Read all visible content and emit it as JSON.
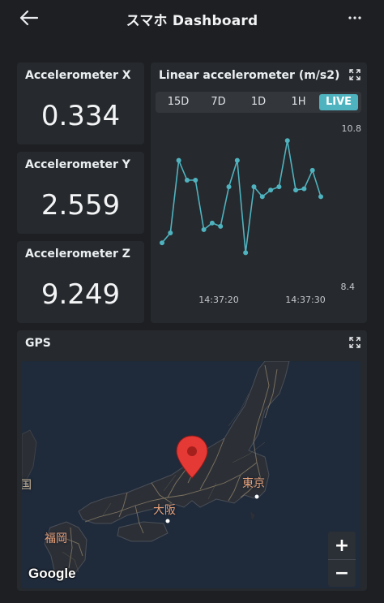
{
  "appbar": {
    "title": "スマホ Dashboard",
    "back_icon": "arrow-left-icon",
    "more_icon": "more-horizontal-icon"
  },
  "stats": [
    {
      "label": "Accelerometer X",
      "value": "0.334"
    },
    {
      "label": "Accelerometer Y",
      "value": "2.559"
    },
    {
      "label": "Accelerometer Z",
      "value": "9.249"
    }
  ],
  "linear_chart": {
    "title": "Linear accelerometer (m/s2)",
    "ranges": [
      "15D",
      "7D",
      "1D",
      "1H",
      "LIVE"
    ],
    "active_range": "LIVE",
    "accent": "#4fb3bf"
  },
  "chart_data": {
    "type": "line",
    "title": "Linear accelerometer (m/s2)",
    "ylim": [
      8.4,
      10.8
    ],
    "y_ticks": [
      "10.8",
      "8.4"
    ],
    "x_ticks": [
      "14:37:20",
      "14:37:30"
    ],
    "series": [
      {
        "color": "#4fb3bf",
        "values": [
          9.05,
          9.2,
          10.3,
          10.0,
          10.0,
          9.25,
          9.35,
          9.3,
          9.9,
          10.3,
          8.9,
          9.9,
          9.75,
          9.85,
          9.9,
          10.6,
          9.85,
          9.87,
          10.15,
          9.75
        ]
      }
    ]
  },
  "gps": {
    "title": "GPS",
    "map_labels": {
      "tokyo": "東京",
      "osaka": "大阪",
      "fukuoka": "福岡",
      "korea_fragment": "国"
    },
    "zoom_in": "+",
    "zoom_out": "−",
    "attribution": "Google"
  }
}
